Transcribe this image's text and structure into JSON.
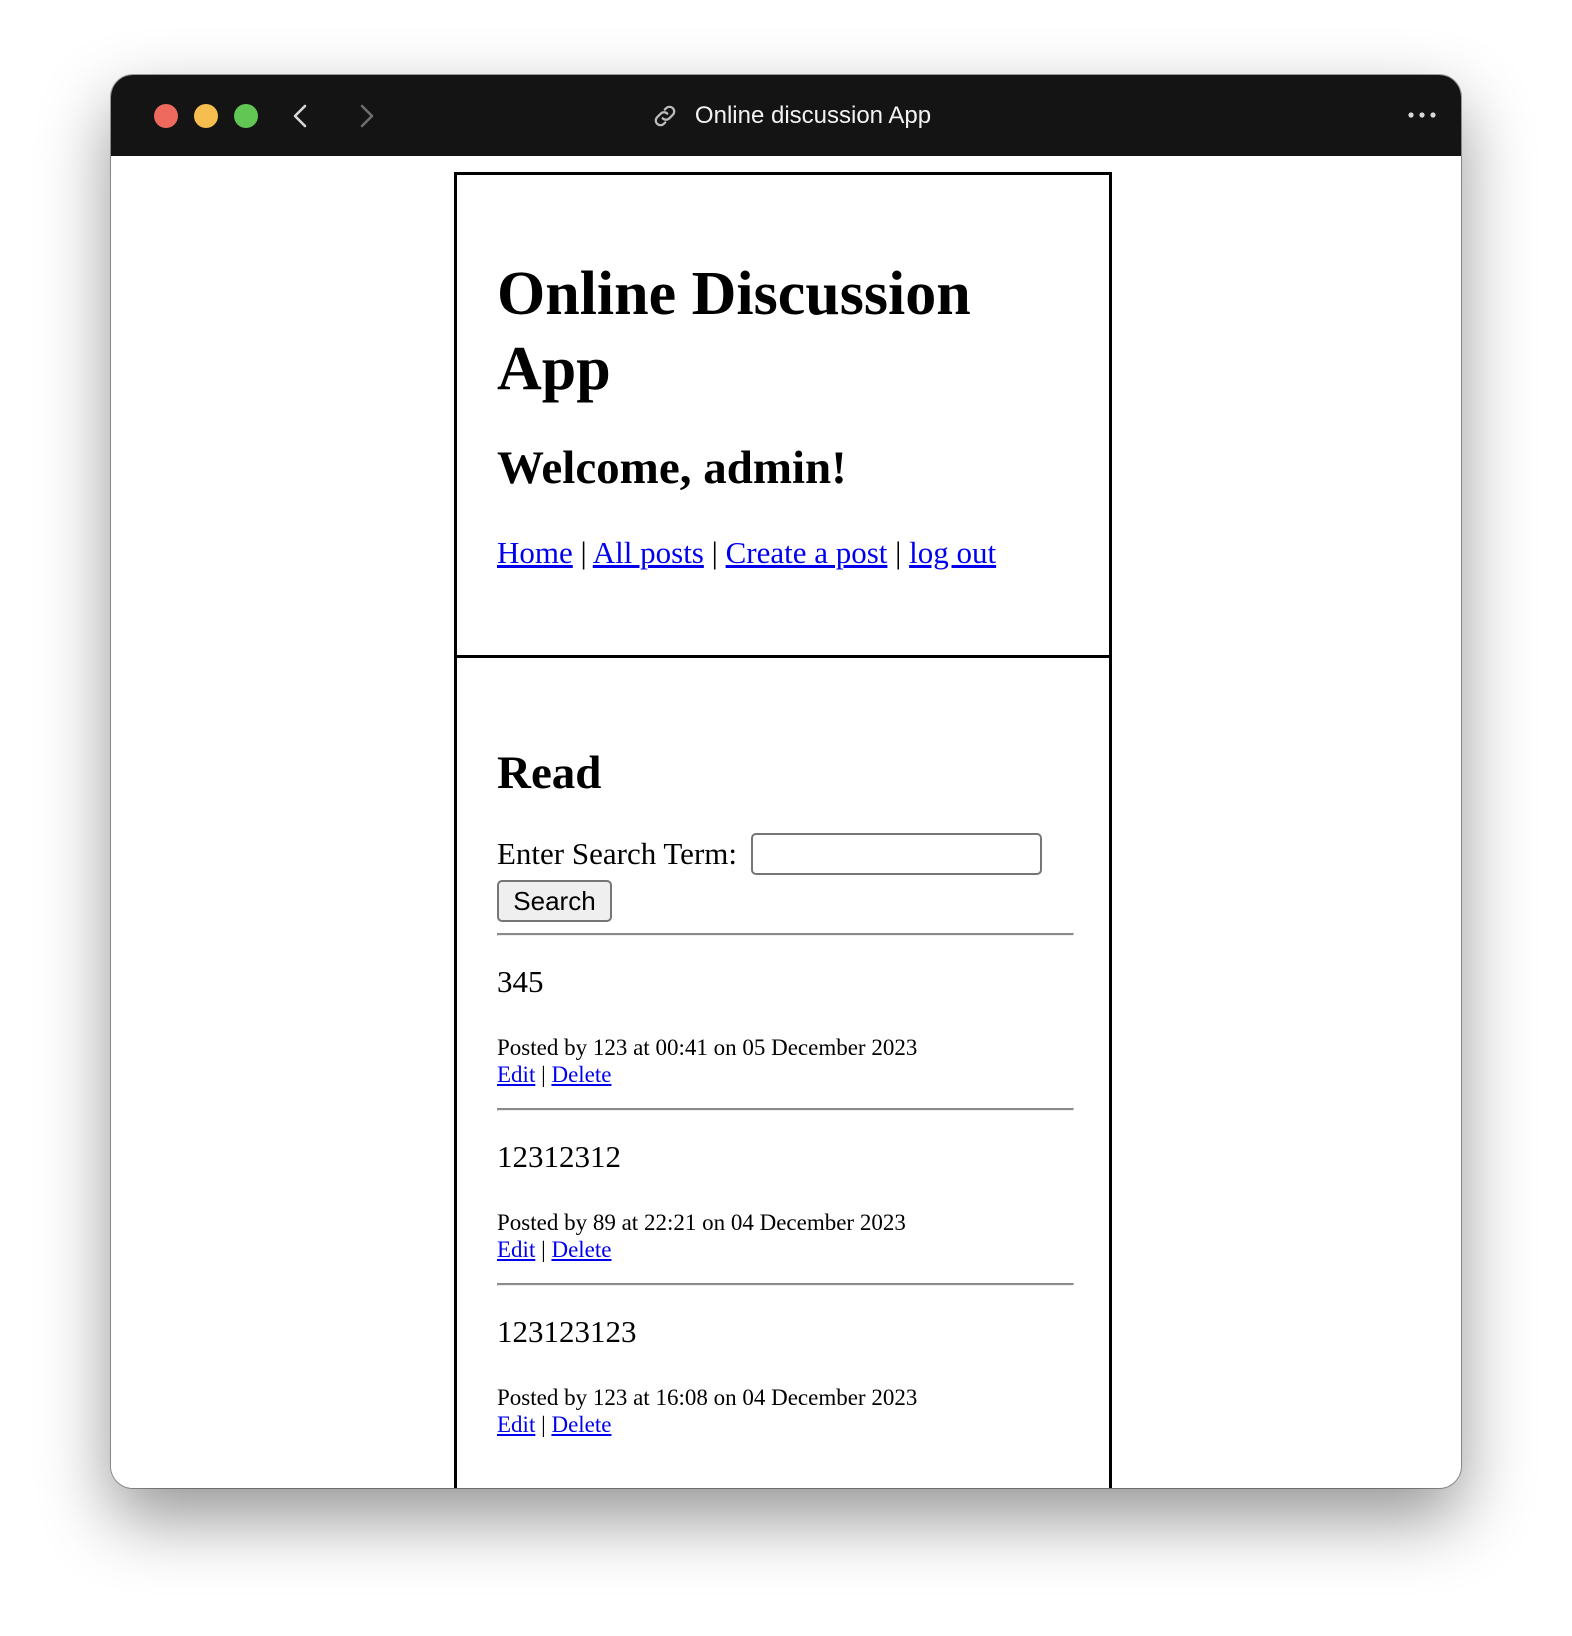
{
  "window": {
    "title": "Online discussion App"
  },
  "header": {
    "app_title": "Online Discussion App",
    "welcome": "Welcome, admin!",
    "nav": {
      "home": "Home",
      "all_posts": "All posts",
      "create_post": "Create a post",
      "log_out": "log out",
      "separator": " | "
    }
  },
  "main": {
    "heading": "Read",
    "search": {
      "label": "Enter Search Term:",
      "value": "",
      "button": "Search"
    },
    "posts": [
      {
        "title": "345",
        "meta": "Posted by 123 at 00:41 on 05 December 2023",
        "edit": "Edit",
        "delete": "Delete"
      },
      {
        "title": "12312312",
        "meta": "Posted by 89 at 22:21 on 04 December 2023",
        "edit": "Edit",
        "delete": "Delete"
      },
      {
        "title": "123123123",
        "meta": "Posted by 123 at 16:08 on 04 December 2023",
        "edit": "Edit",
        "delete": "Delete"
      }
    ]
  },
  "colors": {
    "titlebar": "#141414",
    "link": "#0000ee",
    "close": "#ee6a5f",
    "minimize": "#f5be4f",
    "maximize": "#62c655"
  }
}
